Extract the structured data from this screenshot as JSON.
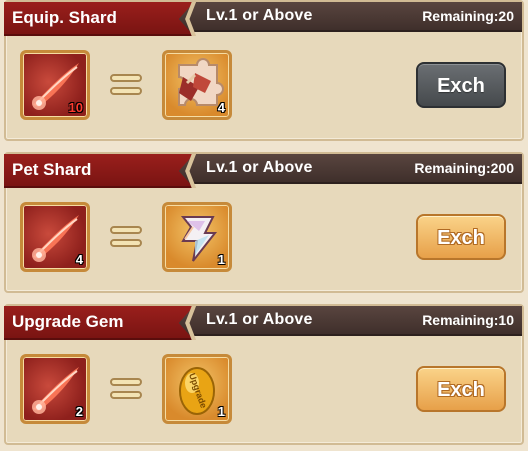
{
  "exchanges": [
    {
      "title": "Equip. Shard",
      "requirement": "Lv.1 or Above",
      "remaining": "Remaining:20",
      "cost": {
        "icon": "red-feather-icon",
        "qty": "10",
        "insufficient": true
      },
      "reward": {
        "icon": "puzzle-equip-shard-icon",
        "qty": "4"
      },
      "button": {
        "label": "Exch",
        "enabled": false
      }
    },
    {
      "title": "Pet Shard",
      "requirement": "Lv.1 or Above",
      "remaining": "Remaining:200",
      "cost": {
        "icon": "red-feather-icon",
        "qty": "4",
        "insufficient": false
      },
      "reward": {
        "icon": "pet-shard-crystal-icon",
        "qty": "1"
      },
      "button": {
        "label": "Exch",
        "enabled": true
      }
    },
    {
      "title": "Upgrade Gem",
      "requirement": "Lv.1 or Above",
      "remaining": "Remaining:10",
      "cost": {
        "icon": "red-feather-icon",
        "qty": "2",
        "insufficient": false
      },
      "reward": {
        "icon": "upgrade-gem-icon",
        "qty": "1",
        "engraving": "Upgrade"
      },
      "button": {
        "label": "Exch",
        "enabled": true
      }
    }
  ],
  "colors": {
    "ribbon": "#8b1a17",
    "header_bar": "#4a3833",
    "panel": "#e7d9bb",
    "button_active": "#f0b35c",
    "button_disabled": "#55595c",
    "insufficient_qty": "#ff3b2f"
  }
}
